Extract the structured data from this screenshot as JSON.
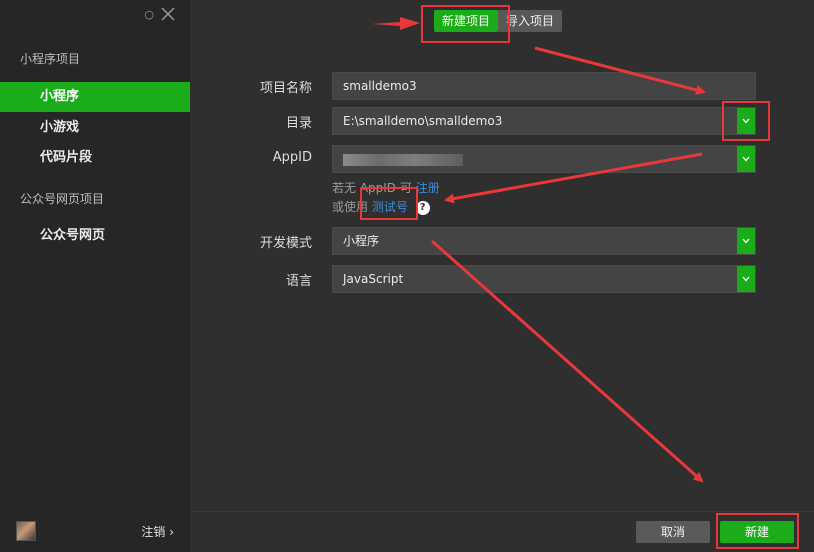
{
  "sidebar": {
    "groups": [
      {
        "label": "小程序项目",
        "items": [
          {
            "label": "小程序",
            "active": true
          },
          {
            "label": "小游戏",
            "active": false
          },
          {
            "label": "代码片段",
            "active": false
          }
        ]
      },
      {
        "label": "公众号网页项目",
        "items": [
          {
            "label": "公众号网页",
            "active": false
          }
        ]
      }
    ],
    "logout_label": "注销 ›"
  },
  "tabs": {
    "new_project": "新建项目",
    "import_project": "导入项目"
  },
  "form": {
    "project_name": {
      "label": "项目名称",
      "value": "smalldemo3"
    },
    "directory": {
      "label": "目录",
      "value": "E:\\smalldemo\\smalldemo3"
    },
    "appid": {
      "label": "AppID"
    },
    "hint_line1_prefix": "若无 AppID 可",
    "hint_line1_link": "注册",
    "hint_line2_prefix": "或使用",
    "hint_line2_link": "测试号",
    "dev_mode": {
      "label": "开发模式",
      "value": "小程序"
    },
    "language": {
      "label": "语言",
      "value": "JavaScript"
    }
  },
  "buttons": {
    "cancel": "取消",
    "create": "新建"
  },
  "colors": {
    "accent": "#1aad19",
    "annotation": "#e8383a"
  }
}
